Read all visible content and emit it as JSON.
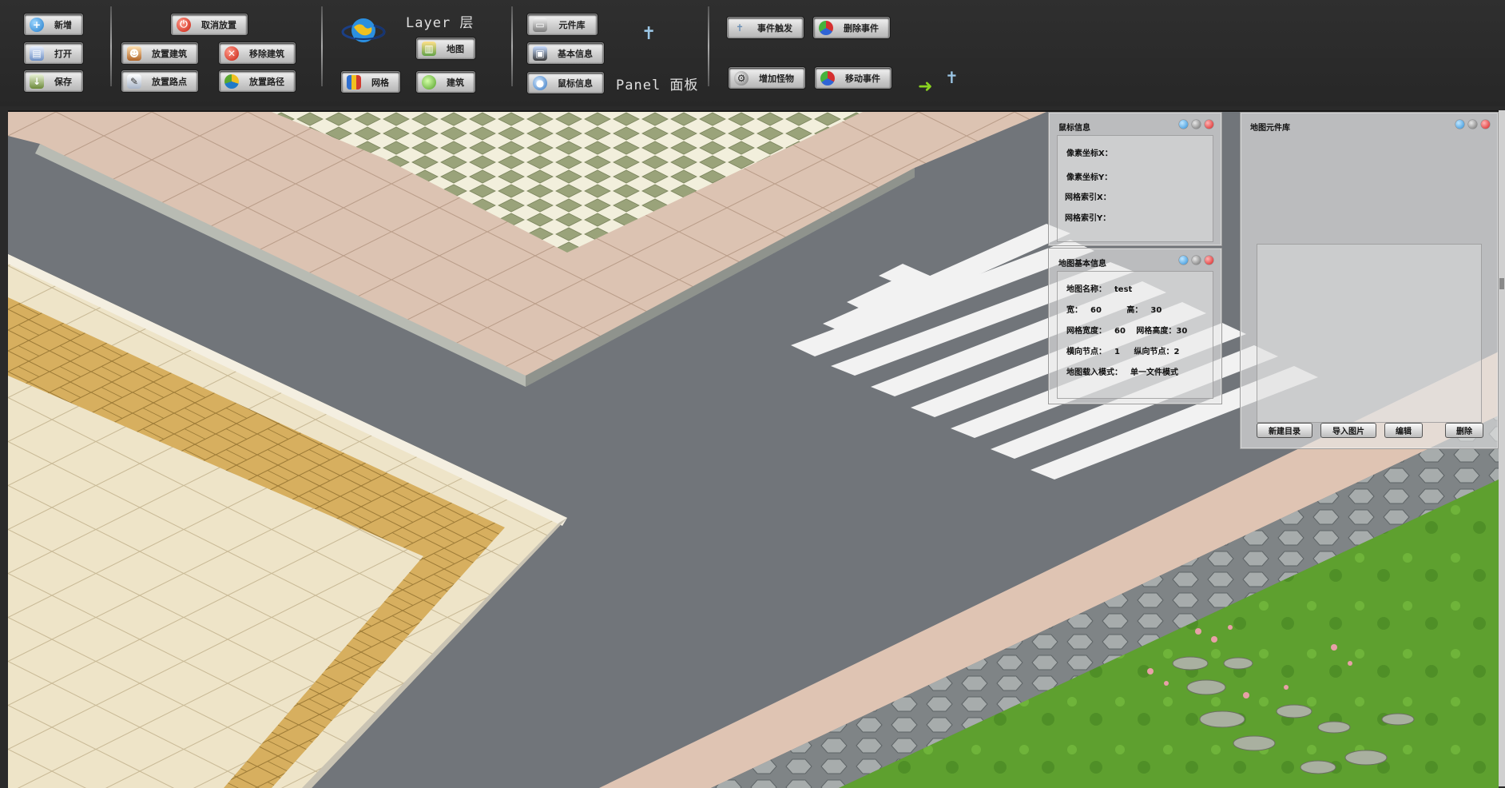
{
  "toolbar": {
    "file": {
      "new": "新增",
      "open": "打开",
      "save": "保存"
    },
    "build": {
      "cancel_place": "取消放置",
      "place_building": "放置建筑",
      "remove_building": "移除建筑",
      "place_waypoint": "放置路点",
      "place_path": "放置路径"
    },
    "layer": {
      "title": "Layer 层",
      "map": "地图",
      "grid": "网格",
      "building": "建筑"
    },
    "panel": {
      "title": "Panel 面板",
      "component_lib": "元件库",
      "basic_info": "基本信息",
      "cursor_info": "鼠标信息"
    },
    "events": {
      "event_bind": "事件触发",
      "delete_event": "删除事件",
      "add_obstacle": "增加怪物",
      "move_event": "移动事件"
    }
  },
  "cursor_panel": {
    "title": "鼠标信息",
    "pixel_x": "像素坐标X：",
    "pixel_y": "像素坐标Y：",
    "grid_x": "网格索引X：",
    "grid_y": "网格索引Y："
  },
  "map_info_panel": {
    "title": "地图基本信息",
    "name_label": "地图名称：",
    "name_value": "test",
    "width_label": "宽：",
    "width_value": "60",
    "height_label": "高：",
    "height_value": "30",
    "grid_w_label": "网格宽度：",
    "grid_w_value": "60",
    "grid_h_label": "网格高度：",
    "grid_h_value": "30",
    "hnode_label": "横向节点：",
    "hnode_value": "1",
    "vnode_label": "纵向节点：",
    "vnode_value": "2",
    "load_label": "地图载入模式：",
    "load_value": "单一文件模式"
  },
  "component_panel": {
    "title": "地图元件库",
    "new_dir": "新建目录",
    "import_img": "导入图片",
    "edit": "编辑",
    "delete": "删除"
  },
  "colors": {
    "toolbar_bg": "#2c2c2c",
    "road": "#6f7377",
    "plaza_tile": "#d9bfae",
    "green_tile": "#9aa27a",
    "yellow_brick": "#d9b364",
    "cream_tile": "#ece1c4",
    "grass": "#5fa52f"
  }
}
